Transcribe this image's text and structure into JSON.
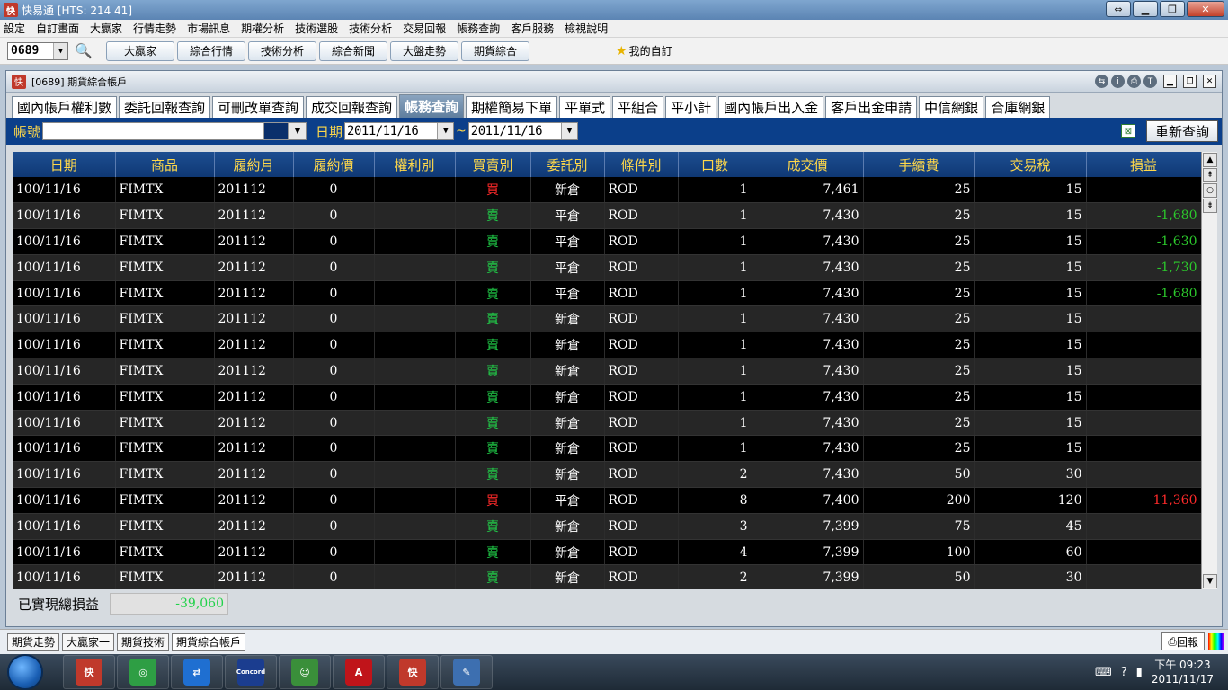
{
  "window": {
    "title": "快易通 [HTS: 214 41]"
  },
  "menu": [
    "設定",
    "自訂畫面",
    "大贏家",
    "行情走勢",
    "市場訊息",
    "期權分析",
    "技術選股",
    "技術分析",
    "交易回報",
    "帳務查詢",
    "客戶服務",
    "檢視說明"
  ],
  "toolbar": {
    "stock_code": "0689",
    "buttons": [
      "大贏家",
      "綜合行情",
      "技術分析",
      "綜合新聞",
      "大盤走勢",
      "期貨綜合"
    ],
    "favorite": "我的自訂"
  },
  "inner": {
    "title": "[0689] 期貨綜合帳戶",
    "tabs": [
      {
        "label": "國內帳戶權利數",
        "active": false
      },
      {
        "label": "委託回報查詢",
        "active": false
      },
      {
        "label": "可刪改單查詢",
        "active": false
      },
      {
        "label": "成交回報查詢",
        "active": false
      },
      {
        "label": "帳務查詢",
        "active": true
      },
      {
        "label": "期權簡易下單",
        "active": false
      },
      {
        "label": "平單式",
        "active": false
      },
      {
        "label": "平組合",
        "active": false
      },
      {
        "label": "平小計",
        "active": false
      },
      {
        "label": "國內帳戶出入金",
        "active": false
      },
      {
        "label": "客戶出金申請",
        "active": false
      },
      {
        "label": "中信網銀",
        "active": false
      },
      {
        "label": "合庫網銀",
        "active": false
      }
    ]
  },
  "filter": {
    "account_label": "帳號",
    "account_value": "",
    "date_label": "日期",
    "date_from": "2011/11/16",
    "tilde": "~",
    "date_to": "2011/11/16",
    "requery": "重新查詢"
  },
  "table": {
    "columns": [
      "日期",
      "商品",
      "履約月",
      "履約價",
      "權利別",
      "買賣別",
      "委託別",
      "條件別",
      "口數",
      "成交價",
      "手續費",
      "交易稅",
      "損益"
    ],
    "rows": [
      [
        "100/11/16",
        "FIMTX",
        "201112",
        "0",
        "",
        "買",
        "新倉",
        "ROD",
        "1",
        "7,461",
        "25",
        "15",
        ""
      ],
      [
        "100/11/16",
        "FIMTX",
        "201112",
        "0",
        "",
        "賣",
        "平倉",
        "ROD",
        "1",
        "7,430",
        "25",
        "15",
        "-1,680"
      ],
      [
        "100/11/16",
        "FIMTX",
        "201112",
        "0",
        "",
        "賣",
        "平倉",
        "ROD",
        "1",
        "7,430",
        "25",
        "15",
        "-1,630"
      ],
      [
        "100/11/16",
        "FIMTX",
        "201112",
        "0",
        "",
        "賣",
        "平倉",
        "ROD",
        "1",
        "7,430",
        "25",
        "15",
        "-1,730"
      ],
      [
        "100/11/16",
        "FIMTX",
        "201112",
        "0",
        "",
        "賣",
        "平倉",
        "ROD",
        "1",
        "7,430",
        "25",
        "15",
        "-1,680"
      ],
      [
        "100/11/16",
        "FIMTX",
        "201112",
        "0",
        "",
        "賣",
        "新倉",
        "ROD",
        "1",
        "7,430",
        "25",
        "15",
        ""
      ],
      [
        "100/11/16",
        "FIMTX",
        "201112",
        "0",
        "",
        "賣",
        "新倉",
        "ROD",
        "1",
        "7,430",
        "25",
        "15",
        ""
      ],
      [
        "100/11/16",
        "FIMTX",
        "201112",
        "0",
        "",
        "賣",
        "新倉",
        "ROD",
        "1",
        "7,430",
        "25",
        "15",
        ""
      ],
      [
        "100/11/16",
        "FIMTX",
        "201112",
        "0",
        "",
        "賣",
        "新倉",
        "ROD",
        "1",
        "7,430",
        "25",
        "15",
        ""
      ],
      [
        "100/11/16",
        "FIMTX",
        "201112",
        "0",
        "",
        "賣",
        "新倉",
        "ROD",
        "1",
        "7,430",
        "25",
        "15",
        ""
      ],
      [
        "100/11/16",
        "FIMTX",
        "201112",
        "0",
        "",
        "賣",
        "新倉",
        "ROD",
        "1",
        "7,430",
        "25",
        "15",
        ""
      ],
      [
        "100/11/16",
        "FIMTX",
        "201112",
        "0",
        "",
        "賣",
        "新倉",
        "ROD",
        "2",
        "7,430",
        "50",
        "30",
        ""
      ],
      [
        "100/11/16",
        "FIMTX",
        "201112",
        "0",
        "",
        "買",
        "平倉",
        "ROD",
        "8",
        "7,400",
        "200",
        "120",
        "11,360"
      ],
      [
        "100/11/16",
        "FIMTX",
        "201112",
        "0",
        "",
        "賣",
        "新倉",
        "ROD",
        "3",
        "7,399",
        "75",
        "45",
        ""
      ],
      [
        "100/11/16",
        "FIMTX",
        "201112",
        "0",
        "",
        "賣",
        "新倉",
        "ROD",
        "4",
        "7,399",
        "100",
        "60",
        ""
      ],
      [
        "100/11/16",
        "FIMTX",
        "201112",
        "0",
        "",
        "賣",
        "新倉",
        "ROD",
        "2",
        "7,399",
        "50",
        "30",
        ""
      ]
    ]
  },
  "summary": {
    "label": "已實現總損益",
    "value": "-39,060"
  },
  "app_tabs": [
    "期貨走勢",
    "大贏家一",
    "期貨技術",
    "期貨綜合帳戶"
  ],
  "reply_button": "回報",
  "taskbar": {
    "items": [
      {
        "icon": "speedtrade-icon",
        "color": "#c0392b",
        "glyph": "快"
      },
      {
        "icon": "chrome-icon",
        "color": "#2e9e44",
        "glyph": "◎"
      },
      {
        "icon": "teamviewer-icon",
        "color": "#1f6fd1",
        "glyph": "⇄"
      },
      {
        "icon": "concord-icon",
        "color": "#1b3d8f",
        "glyph": "Concord"
      },
      {
        "icon": "messenger-icon",
        "color": "#3a8f3a",
        "glyph": "☺"
      },
      {
        "icon": "acrobat-icon",
        "color": "#c0141a",
        "glyph": "A"
      },
      {
        "icon": "speedtrade-icon-2",
        "color": "#c0392b",
        "glyph": "快"
      },
      {
        "icon": "paint-icon",
        "color": "#3d6fb0",
        "glyph": "✎"
      }
    ],
    "clock_time": "下午 09:23",
    "clock_date": "2011/11/17"
  },
  "colors": {
    "buy": "#ff2a2a",
    "sell": "#21d24a",
    "header_text": "#ffd84a",
    "header_bg": "#1d4e91",
    "filter_bg": "#0b3f8a"
  }
}
